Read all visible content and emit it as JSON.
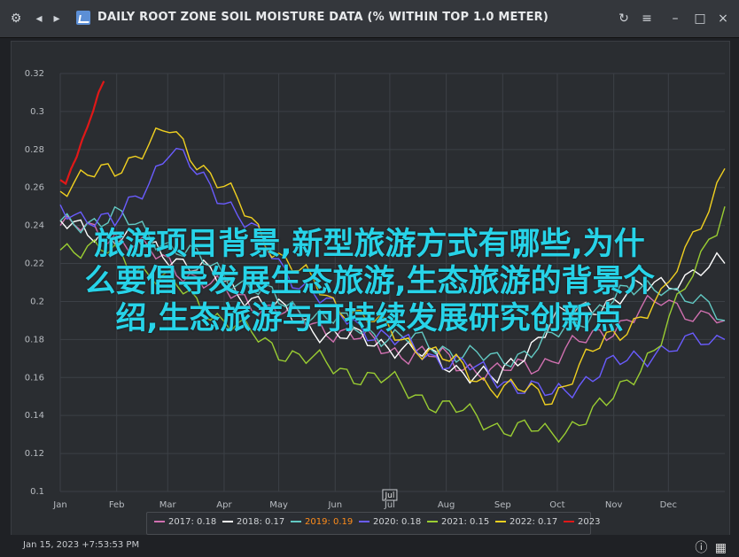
{
  "window": {
    "title": "DAILY ROOT ZONE SOIL MOISTURE DATA (% WITHIN TOP 1.0 METER)",
    "nav_icons": [
      "settings-icon",
      "back-icon",
      "forward-icon"
    ],
    "controls": [
      "refresh-icon",
      "menu-icon",
      "minimize-icon",
      "maximize-icon",
      "close-icon"
    ]
  },
  "status": {
    "timestamp": "Jan 15, 2023 +7:53:53 PM",
    "icons": [
      "info-icon",
      "excel-export-icon"
    ]
  },
  "overlay": {
    "line1": "旅游项目背景,新型旅游方式有哪些,为什",
    "line2": "么要倡导发展生态旅游,生态旅游的背景介",
    "line3": "绍,生态旅游与可持续发展研究创新点"
  },
  "chart_data": {
    "type": "line",
    "xlabel": "",
    "ylabel": "",
    "ylim": [
      0.1,
      0.32
    ],
    "yticks": [
      "0.1",
      "0.12",
      "0.14",
      "0.16",
      "0.18",
      "0.2",
      "0.22",
      "0.24",
      "0.26",
      "0.28",
      "0.3",
      "0.32"
    ],
    "x_months": [
      "Jan",
      "Feb",
      "Mar",
      "Apr",
      "May",
      "Jun",
      "Jul",
      "Aug",
      "Sep",
      "Oct",
      "Nov",
      "Dec"
    ],
    "marker_label": "Jul",
    "grid": true,
    "legend_position": "bottom",
    "colors": {
      "2017": "#d070b0",
      "2018": "#ffffff",
      "2019": "#ff8c1a",
      "2020": "#6a5cff",
      "2021": "#9acd32",
      "2022": "#f0d020",
      "2023": "#e01818",
      "teal": "#62c9c3"
    },
    "series": [
      {
        "name": "2017: 0.18",
        "color": "#d070b0",
        "x": [
          0,
          30,
          60,
          90,
          120,
          150,
          180,
          210,
          240,
          270,
          300,
          330,
          365
        ],
        "y": [
          0.24,
          0.235,
          0.22,
          0.205,
          0.195,
          0.185,
          0.175,
          0.17,
          0.162,
          0.17,
          0.185,
          0.2,
          0.19
        ]
      },
      {
        "name": "2018: 0.17",
        "color": "#ffffff",
        "x": [
          0,
          30,
          60,
          90,
          120,
          150,
          180,
          210,
          240,
          270,
          300,
          330,
          365
        ],
        "y": [
          0.24,
          0.235,
          0.225,
          0.21,
          0.195,
          0.182,
          0.178,
          0.168,
          0.158,
          0.19,
          0.2,
          0.21,
          0.22
        ]
      },
      {
        "name": "2019: 0.19",
        "color": "#62c9c3",
        "x": [
          0,
          30,
          60,
          90,
          120,
          150,
          180,
          210,
          240,
          270,
          300,
          330,
          365
        ],
        "y": [
          0.24,
          0.245,
          0.23,
          0.215,
          0.2,
          0.19,
          0.182,
          0.176,
          0.168,
          0.18,
          0.2,
          0.21,
          0.19
        ]
      },
      {
        "name": "2020: 0.18",
        "color": "#6a5cff",
        "x": [
          0,
          30,
          60,
          90,
          120,
          150,
          180,
          210,
          240,
          270,
          300,
          330,
          365
        ],
        "y": [
          0.25,
          0.24,
          0.28,
          0.255,
          0.22,
          0.195,
          0.18,
          0.17,
          0.16,
          0.15,
          0.165,
          0.175,
          0.18
        ]
      },
      {
        "name": "2021: 0.15",
        "color": "#9acd32",
        "x": [
          0,
          30,
          60,
          90,
          120,
          150,
          180,
          210,
          240,
          270,
          300,
          330,
          365
        ],
        "y": [
          0.23,
          0.225,
          0.21,
          0.19,
          0.175,
          0.165,
          0.158,
          0.145,
          0.135,
          0.13,
          0.145,
          0.18,
          0.25
        ]
      },
      {
        "name": "2022: 0.17",
        "color": "#f0d020",
        "x": [
          0,
          30,
          60,
          90,
          120,
          150,
          180,
          210,
          240,
          270,
          300,
          330,
          365
        ],
        "y": [
          0.26,
          0.27,
          0.29,
          0.26,
          0.225,
          0.2,
          0.185,
          0.17,
          0.155,
          0.15,
          0.18,
          0.2,
          0.27
        ]
      },
      {
        "name": "2023",
        "color": "#e01818",
        "x": [
          0,
          3,
          6,
          9,
          12,
          15,
          18,
          21,
          24
        ],
        "y": [
          0.264,
          0.262,
          0.27,
          0.276,
          0.285,
          0.292,
          0.3,
          0.31,
          0.316
        ]
      }
    ]
  }
}
